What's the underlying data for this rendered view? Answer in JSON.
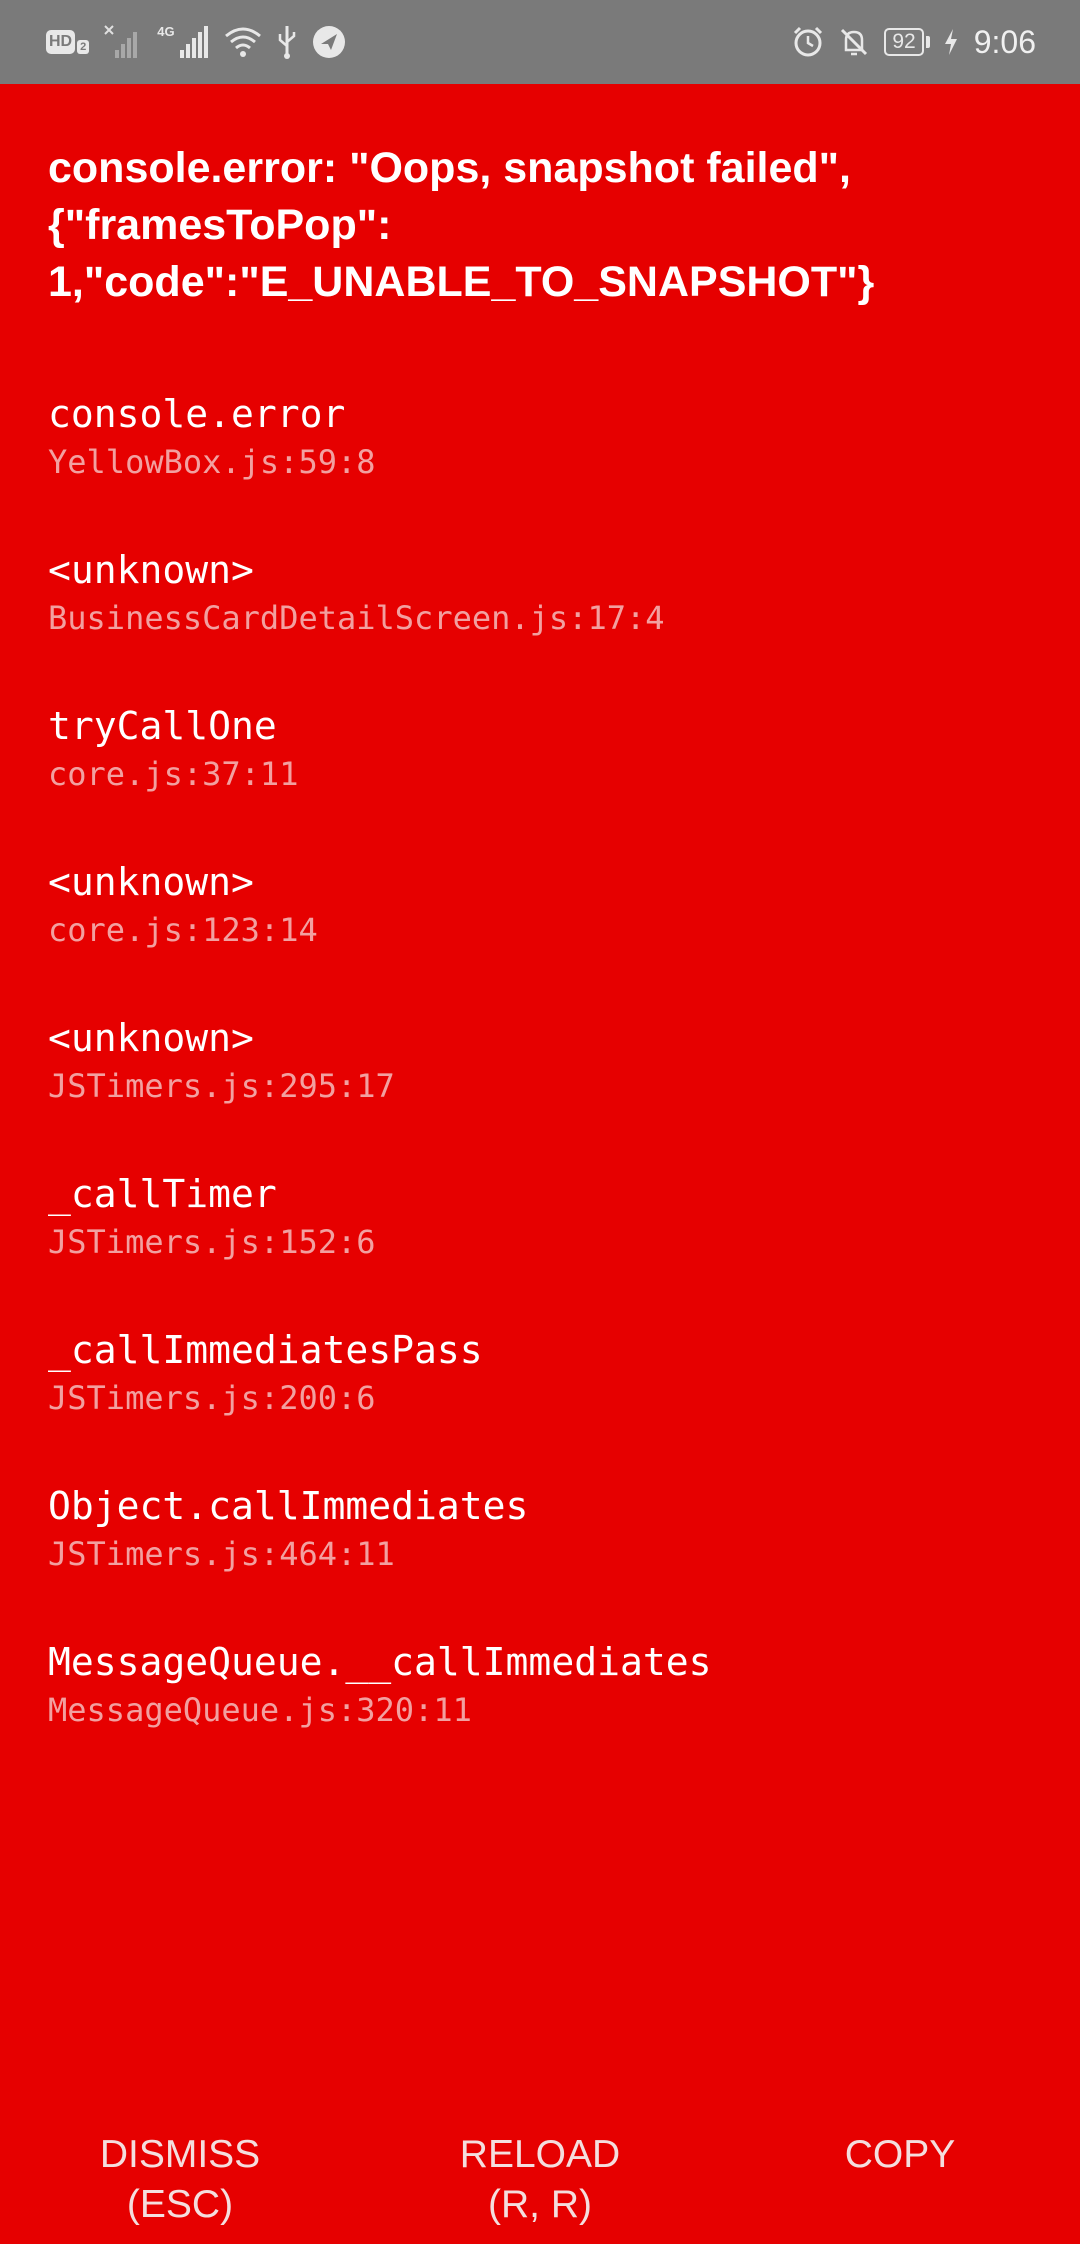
{
  "status_bar": {
    "hd_label": "HD",
    "hd_sub": "2",
    "network_label": "4G",
    "battery_level": "92",
    "time": "9:06",
    "icons": [
      "hd-icon",
      "signal-no-sim-icon",
      "signal-4g-icon",
      "wifi-icon",
      "usb-icon",
      "app-notification-icon",
      "alarm-icon",
      "mute-icon",
      "battery-icon",
      "charging-icon"
    ]
  },
  "error": {
    "title": "console.error: \"Oops, snapshot failed\", {\"framesToPop\": 1,\"code\":\"E_UNABLE_TO_SNAPSHOT\"}"
  },
  "stack": [
    {
      "fn": "console.error",
      "loc": "YellowBox.js:59:8"
    },
    {
      "fn": "<unknown>",
      "loc": "BusinessCardDetailScreen.js:17:4"
    },
    {
      "fn": "tryCallOne",
      "loc": "core.js:37:11"
    },
    {
      "fn": "<unknown>",
      "loc": "core.js:123:14"
    },
    {
      "fn": "<unknown>",
      "loc": "JSTimers.js:295:17"
    },
    {
      "fn": "_callTimer",
      "loc": "JSTimers.js:152:6"
    },
    {
      "fn": "_callImmediatesPass",
      "loc": "JSTimers.js:200:6"
    },
    {
      "fn": "Object.callImmediates",
      "loc": "JSTimers.js:464:11"
    },
    {
      "fn": "MessageQueue.__callImmediates",
      "loc": "MessageQueue.js:320:11"
    }
  ],
  "footer": {
    "dismiss_label": "DISMISS",
    "dismiss_shortcut": "(ESC)",
    "reload_label": "RELOAD",
    "reload_shortcut": "(R, R)",
    "copy_label": "COPY"
  },
  "colors": {
    "background": "#e60000",
    "status_bar": "#7a7a7a",
    "text": "#ffffff",
    "location_text": "#f2a0a0"
  }
}
